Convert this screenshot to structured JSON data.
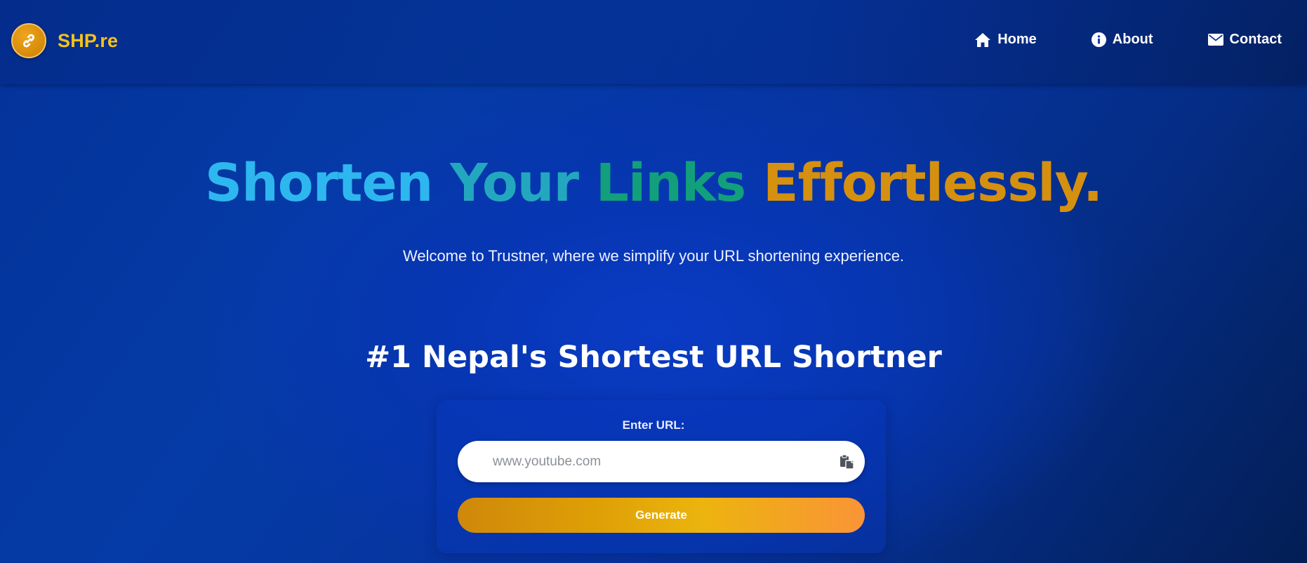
{
  "brand": {
    "name": "SHP.re",
    "logo_icon": "link-icon",
    "accent": "#f4c21a"
  },
  "nav": {
    "items": [
      {
        "label": "Home",
        "icon": "home-icon"
      },
      {
        "label": "About",
        "icon": "info-icon"
      },
      {
        "label": "Contact",
        "icon": "envelope-icon"
      }
    ]
  },
  "hero": {
    "title_words": [
      "Shorten",
      "Your",
      "Links",
      "Effortlessly."
    ],
    "title_colors": [
      "#2eb6ef",
      "#23a7bf",
      "#11a07b",
      "#d6900f"
    ],
    "subtitle": "Welcome to Trustner, where we simplify your URL shortening experience."
  },
  "tagline": "#1 Nepal's Shortest URL Shortner",
  "form": {
    "label": "Enter URL:",
    "input_placeholder": "www.youtube.com",
    "input_value": "",
    "paste_icon": "clipboard-paste-icon",
    "generate_label": "Generate"
  }
}
